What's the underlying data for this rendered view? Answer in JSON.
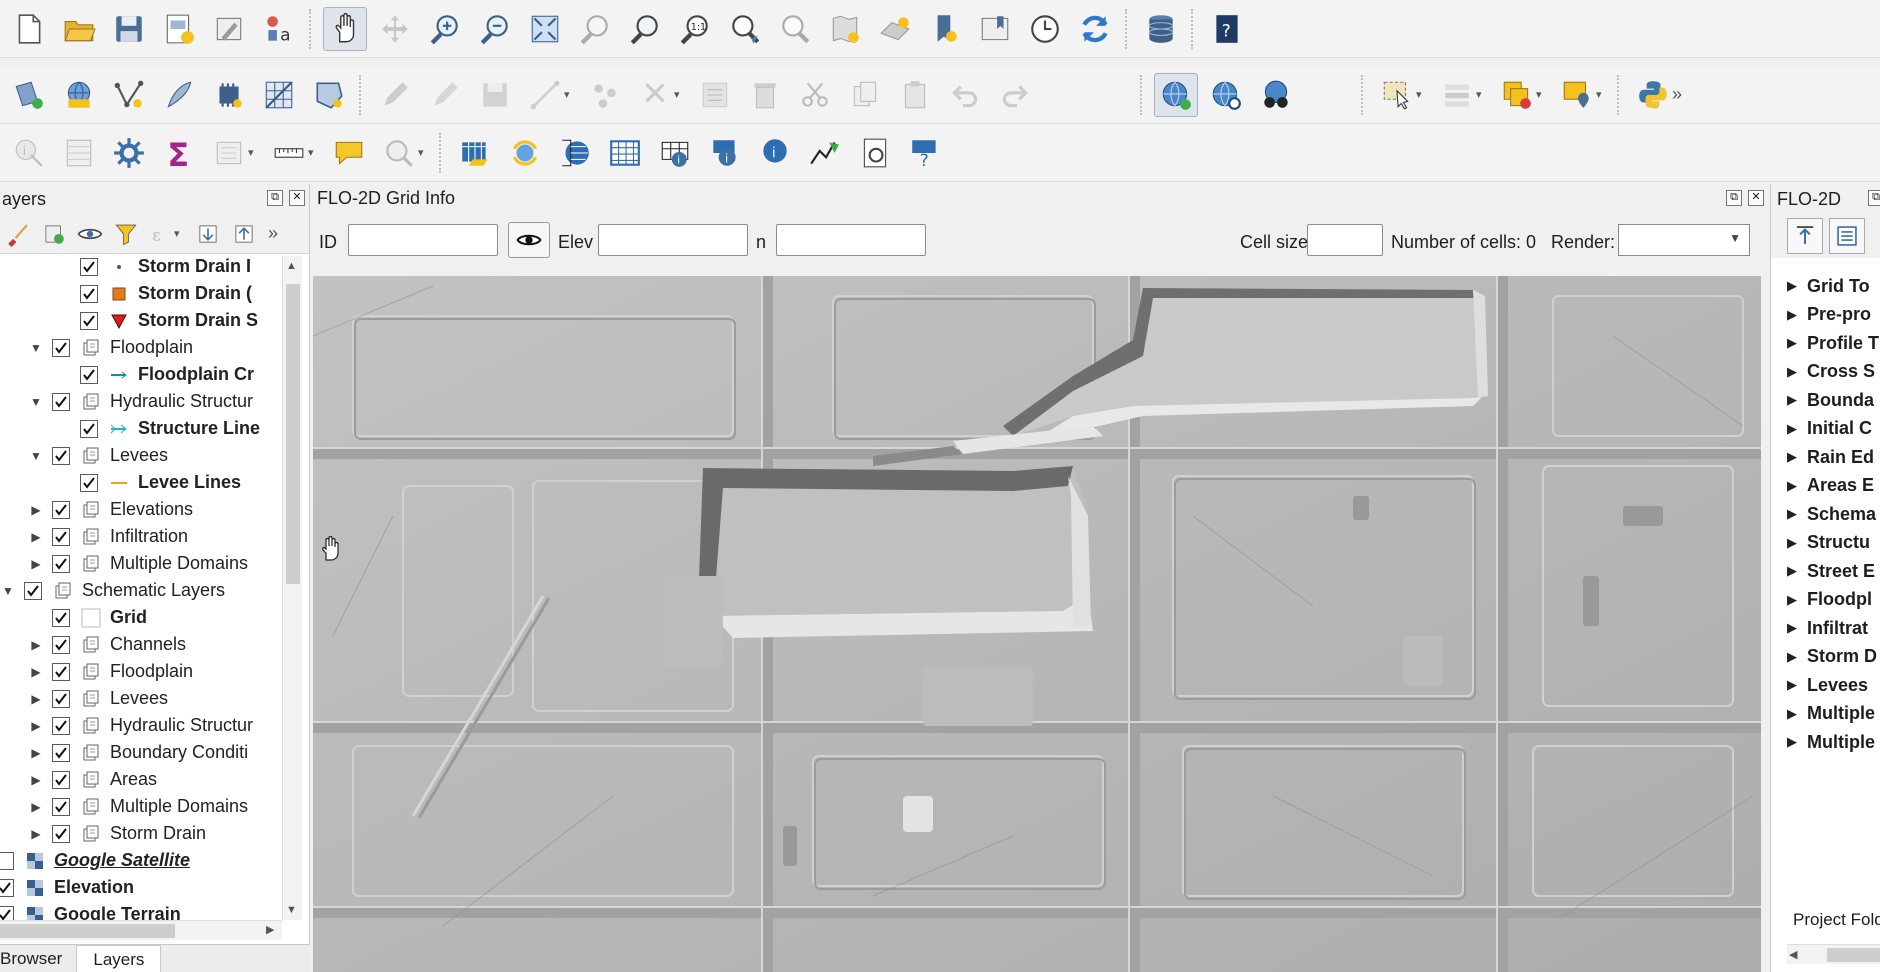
{
  "toolbar1": {
    "icons": [
      "new-project-icon",
      "open-project-icon",
      "save-project-icon",
      "new-print-layout-icon",
      "style-manager-icon",
      "label-icon",
      "pan-icon",
      "pan-to-selection-icon",
      "zoom-in-icon",
      "zoom-out-icon",
      "zoom-full-icon",
      "zoom-to-selection-icon",
      "zoom-to-layer-icon",
      "zoom-native-icon",
      "zoom-last-icon",
      "zoom-next-icon",
      "new-map-view-icon",
      "new-3d-view-icon",
      "new-bookmark-icon",
      "show-bookmarks-icon",
      "temporal-controller-icon",
      "refresh-icon",
      "database-icon",
      "help-icon"
    ],
    "active": "pan-icon"
  },
  "layers_panel": {
    "title": "ayers",
    "tabs": [
      "Browser",
      "Layers"
    ],
    "active_tab": "Layers",
    "items": [
      {
        "label": "Storm Drain I",
        "indent": 3,
        "checked": true,
        "icon": "point-icon",
        "bold": true,
        "twisty": ""
      },
      {
        "label": "Storm Drain (",
        "indent": 3,
        "checked": true,
        "icon": "square-orange-icon",
        "bold": true,
        "twisty": ""
      },
      {
        "label": "Storm Drain S",
        "indent": 3,
        "checked": true,
        "icon": "triangle-red-icon",
        "bold": true,
        "twisty": ""
      },
      {
        "label": "Floodplain",
        "indent": 2,
        "checked": true,
        "icon": "group-icon",
        "bold": false,
        "twisty": "down"
      },
      {
        "label": "Floodplain Cr",
        "indent": 3,
        "checked": true,
        "icon": "line-teal-icon",
        "bold": true,
        "twisty": ""
      },
      {
        "label": "Hydraulic Structur",
        "indent": 2,
        "checked": true,
        "icon": "group-icon",
        "bold": false,
        "twisty": "down"
      },
      {
        "label": "Structure Line",
        "indent": 3,
        "checked": true,
        "icon": "arrow-line-icon",
        "bold": true,
        "twisty": ""
      },
      {
        "label": "Levees",
        "indent": 2,
        "checked": true,
        "icon": "group-icon",
        "bold": false,
        "twisty": "down"
      },
      {
        "label": "Levee Lines",
        "indent": 3,
        "checked": true,
        "icon": "line-orange-icon",
        "bold": true,
        "twisty": ""
      },
      {
        "label": "Elevations",
        "indent": 2,
        "checked": true,
        "icon": "group-icon",
        "bold": false,
        "twisty": "right"
      },
      {
        "label": "Infiltration",
        "indent": 2,
        "checked": true,
        "icon": "group-icon",
        "bold": false,
        "twisty": "right"
      },
      {
        "label": "Multiple Domains",
        "indent": 2,
        "checked": true,
        "icon": "group-icon",
        "bold": false,
        "twisty": "right"
      },
      {
        "label": "Schematic Layers",
        "indent": 1,
        "checked": true,
        "icon": "group-icon",
        "bold": false,
        "twisty": "down"
      },
      {
        "label": "Grid",
        "indent": 2,
        "checked": true,
        "icon": "empty-square-icon",
        "bold": true,
        "twisty": ""
      },
      {
        "label": "Channels",
        "indent": 2,
        "checked": true,
        "icon": "group-icon",
        "bold": false,
        "twisty": "right"
      },
      {
        "label": "Floodplain",
        "indent": 2,
        "checked": true,
        "icon": "group-icon",
        "bold": false,
        "twisty": "right"
      },
      {
        "label": "Levees",
        "indent": 2,
        "checked": true,
        "icon": "group-icon",
        "bold": false,
        "twisty": "right"
      },
      {
        "label": "Hydraulic Structur",
        "indent": 2,
        "checked": true,
        "icon": "group-icon",
        "bold": false,
        "twisty": "right"
      },
      {
        "label": "Boundary Conditi",
        "indent": 2,
        "checked": true,
        "icon": "group-icon",
        "bold": false,
        "twisty": "right"
      },
      {
        "label": "Areas",
        "indent": 2,
        "checked": true,
        "icon": "group-icon",
        "bold": false,
        "twisty": "right"
      },
      {
        "label": "Multiple Domains",
        "indent": 2,
        "checked": true,
        "icon": "group-icon",
        "bold": false,
        "twisty": "right"
      },
      {
        "label": "Storm Drain",
        "indent": 2,
        "checked": true,
        "icon": "group-icon",
        "bold": false,
        "twisty": "right"
      },
      {
        "label": "Google Satellite",
        "indent": 0,
        "checked": false,
        "icon": "raster-icon",
        "bold": true,
        "italic": true,
        "twisty": ""
      },
      {
        "label": "Elevation",
        "indent": 0,
        "checked": true,
        "icon": "raster-icon",
        "bold": true,
        "twisty": ""
      },
      {
        "label": "Google Terrain",
        "indent": 0,
        "checked": true,
        "icon": "raster-icon",
        "bold": true,
        "twisty": ""
      }
    ]
  },
  "grid_info": {
    "title": "FLO-2D Grid Info",
    "id_label": "ID",
    "id_value": "",
    "elev_label": "Elev",
    "elev_value": "",
    "n_label": "n",
    "n_value": "",
    "cell_size_label": "Cell size",
    "cell_size_value": "",
    "num_cells_text": "Number of cells: 0",
    "render_label": "Render:",
    "render_value": ""
  },
  "flo2d_panel": {
    "title": "FLO-2D",
    "items": [
      "Grid To",
      "Pre-pro",
      "Profile T",
      "Cross S",
      "Bounda",
      "Initial C",
      "Rain Ed",
      "Areas E",
      "Schema",
      "Structu",
      "Street E",
      "Floodpl",
      "Infiltrat",
      "Storm D",
      "Levees",
      "Multiple",
      "Multiple"
    ],
    "footer": "Project Fold"
  }
}
